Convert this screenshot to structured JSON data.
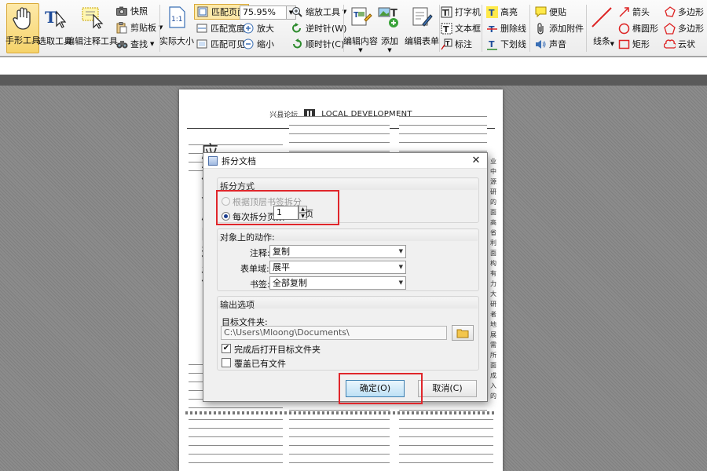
{
  "toolbar": {
    "hand_tool": "手形工具",
    "select_tool": "选取工具",
    "edit_annot_tool": "编辑注释工具",
    "snapshot": "快照",
    "clipboard": "剪贴板",
    "find": "查找",
    "actual_size": "实际大小",
    "actual_size_icon_text": "1:1",
    "fit_page": "匹配页面",
    "fit_width": "匹配宽度",
    "fit_visible": "匹配可见",
    "zoom_value": "75.95%",
    "zoom_tool": "缩放工具",
    "zoom_in": "放大",
    "zoom_out": "缩小",
    "rotate_ccw": "逆时针(W)",
    "rotate_cw": "顺时针(C)",
    "edit_content": "编辑内容",
    "add": "添加",
    "edit_form": "编辑表单",
    "typewriter": "打字机",
    "textbox": "文本框",
    "callout": "标注",
    "highlight": "高亮",
    "strikeout": "删除线",
    "underline": "下划线",
    "note": "便贴",
    "attach": "添加附件",
    "sound": "声音",
    "line": "线条",
    "arrow": "箭头",
    "ellipse": "椭圆形",
    "rectangle": "矩形",
    "polygon": "多边形",
    "polyline": "多边形",
    "cloud": "云状"
  },
  "page": {
    "header_cn": "兴县论坛",
    "header_en": "LOCAL DEVELOPMENT",
    "big_chars": [
      "应",
      "加",
      "发",
      "展",
      "的",
      "我",
      "运"
    ],
    "right_chars": [
      "业",
      "中",
      "源",
      "研",
      "的",
      "面",
      "高",
      "省",
      "利",
      "面",
      "构",
      "有",
      "力",
      "大",
      "研",
      "者",
      "地",
      "展",
      "需",
      "所",
      "面",
      "成",
      "入",
      "的"
    ]
  },
  "dialog": {
    "title": "拆分文档",
    "close": "✕",
    "split_method": {
      "title": "拆分方式",
      "by_bookmark": "根据顶层书签拆分",
      "by_pages": "每次拆分页数",
      "pages_value": "1",
      "pages_unit": "页"
    },
    "actions": {
      "title": "对象上的动作:",
      "annot_label": "注释:",
      "annot_value": "复制",
      "form_label": "表单域:",
      "form_value": "展平",
      "bookmark_label": "书签:",
      "bookmark_value": "全部复制"
    },
    "output": {
      "title": "输出选项",
      "folder_label": "目标文件夹:",
      "folder_path": "C:\\Users\\Mloong\\Documents\\",
      "open_after": "完成后打开目标文件夹",
      "overwrite": "覆盖已有文件"
    },
    "ok": "确定(O)",
    "cancel": "取消(C)"
  },
  "colors": {
    "highlight_red": "#e0262b",
    "active_yellow": "#f6d36b",
    "radio_selected": "#1a3d8f"
  }
}
